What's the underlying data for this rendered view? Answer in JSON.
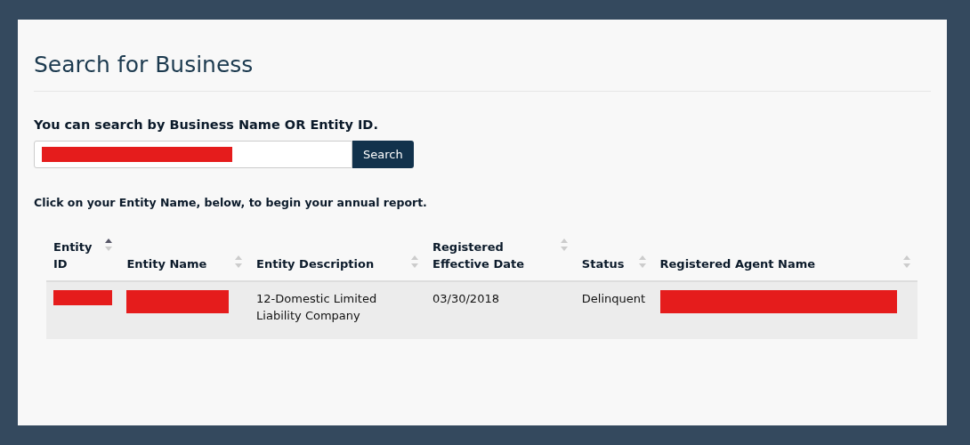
{
  "page_title": "Search for Business",
  "search": {
    "label": "You can search by Business Name OR Entity ID.",
    "value_redacted": true,
    "button": "Search"
  },
  "instruction": "Click on your Entity Name, below, to begin your annual report.",
  "table": {
    "columns": [
      {
        "label": "Entity ID",
        "sorted": true
      },
      {
        "label": "Entity Name",
        "sorted": false
      },
      {
        "label": "Entity Description",
        "sorted": false
      },
      {
        "label": "Registered Effective Date",
        "sorted": false
      },
      {
        "label": "Status",
        "sorted": false
      },
      {
        "label": "Registered Agent Name",
        "sorted": false
      }
    ],
    "rows": [
      {
        "cells": [
          {
            "kind": "redacted"
          },
          {
            "kind": "redacted"
          },
          {
            "kind": "text",
            "text": "12-Domestic Limited Liability Company"
          },
          {
            "kind": "text",
            "text": "03/30/2018"
          },
          {
            "kind": "text",
            "text": "Delinquent"
          },
          {
            "kind": "redacted"
          }
        ]
      }
    ]
  }
}
